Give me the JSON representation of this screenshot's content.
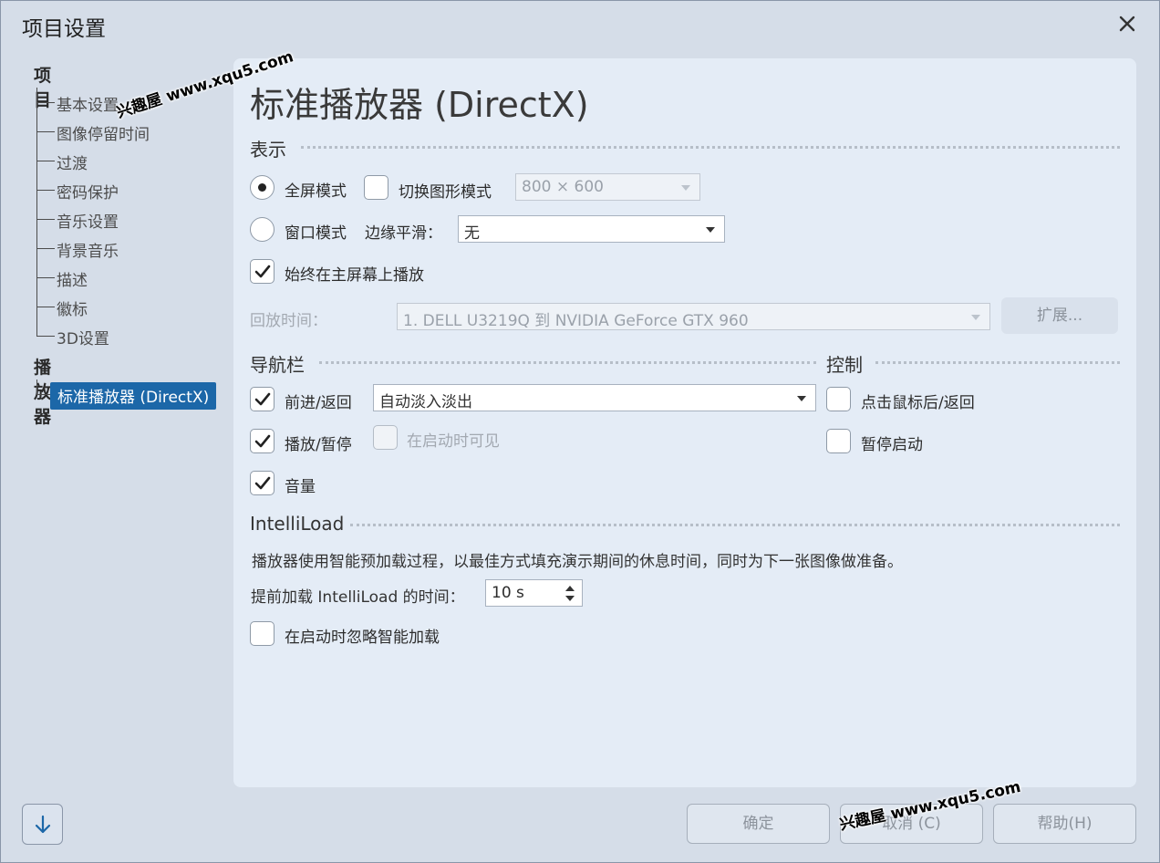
{
  "window": {
    "title": "项目设置"
  },
  "sidebar": {
    "category_project": "项目",
    "project_items": [
      "基本设置",
      "图像停留时间",
      "过渡",
      "密码保护",
      "音乐设置",
      "背景音乐",
      "描述",
      "徽标",
      "3D设置"
    ],
    "category_player": "播放器",
    "player_items": [
      "标准播放器 (DirectX)"
    ]
  },
  "main": {
    "page_title": "标准播放器 (DirectX)",
    "display": {
      "heading": "表示",
      "fullscreen_label": "全屏模式",
      "fullscreen_checked": true,
      "switch_graphics_label": "切换图形模式",
      "switch_graphics_checked": false,
      "resolution_value": "800 × 600",
      "window_mode_label": "窗口模式",
      "window_mode_checked": false,
      "edge_smoothing_label": "边缘平滑：",
      "edge_smoothing_value": "无",
      "always_primary_label": "始终在主屏幕上播放",
      "always_primary_checked": true,
      "playback_time_label": "回放时间：",
      "playback_device_value": "1. DELL U3219Q 到 NVIDIA GeForce GTX 960",
      "extend_button": "扩展..."
    },
    "navbar": {
      "heading": "导航栏",
      "forward_back_label": "前进/返回",
      "forward_back_checked": true,
      "fade_value": "自动淡入淡出",
      "play_pause_label": "播放/暂停",
      "play_pause_checked": true,
      "visible_on_start_label": "在启动时可见",
      "visible_on_start_checked": false,
      "volume_label": "音量",
      "volume_checked": true
    },
    "control": {
      "heading": "控制",
      "click_back_label": "点击鼠标后/返回",
      "click_back_checked": false,
      "pause_start_label": "暂停启动",
      "pause_start_checked": false
    },
    "intelliload": {
      "heading": "IntelliLoad",
      "description": "播放器使用智能预加载过程，以最佳方式填充演示期间的休息时间，同时为下一张图像做准备。",
      "preload_label": "提前加载 IntelliLoad 的时间：",
      "preload_value": "10 s",
      "ignore_label": "在启动时忽略智能加载",
      "ignore_checked": false
    }
  },
  "footer": {
    "ok_button": "确定",
    "cancel_button": "取消 (C)",
    "help_button": "帮助(H)"
  },
  "watermarks": [
    "兴趣屋 www.xqu5.com",
    "兴趣屋 www.xqu5.com"
  ],
  "colors": {
    "selection": "#1c67a8",
    "panel": "#e4ecf6",
    "window_bg": "#d5dde8",
    "accent_icon": "#1c67a8"
  }
}
